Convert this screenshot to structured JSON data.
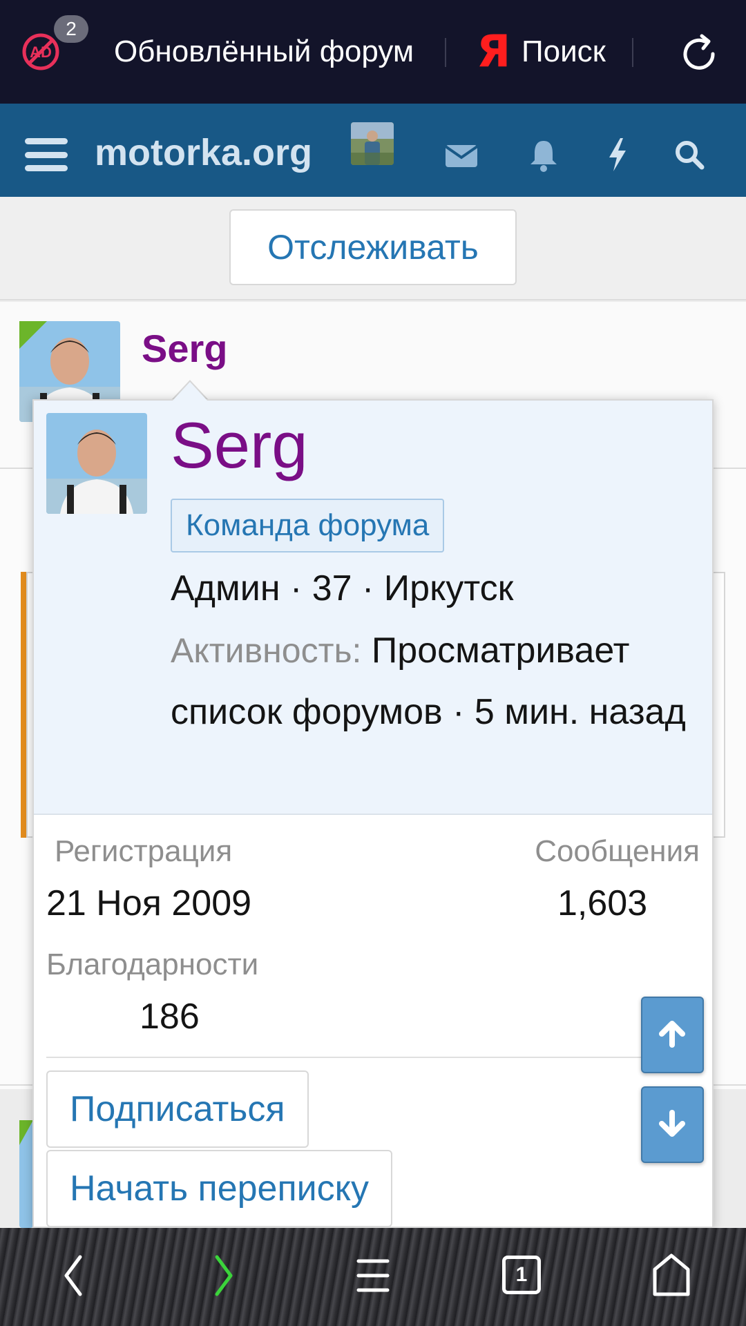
{
  "browser": {
    "adblock_count": "2",
    "tab_title": "Обновлённый форум",
    "yandex_logo": "Я",
    "search_label": "Поиск",
    "icons": [
      "adblock-icon",
      "reload-icon"
    ]
  },
  "header": {
    "site_name": "motorka.org",
    "icons": [
      "menu-icon",
      "user-avatar",
      "envelope-icon",
      "bell-icon",
      "lightning-icon",
      "search-icon"
    ],
    "color": "#185886"
  },
  "page": {
    "follow_label": "Отслеживать",
    "author_name": "Serg"
  },
  "tooltip": {
    "name": "Serg",
    "badge": "Команда форума",
    "info": "Админ · 37 · Иркутск",
    "activity_label": "Активность:",
    "activity_value": "Просматривает список форумов · 5 мин. назад",
    "stats": {
      "registration_label": "Регистрация",
      "registration_value": "21 Ноя 2009",
      "messages_label": "Сообщения",
      "messages_value": "1,603",
      "thanks_label": "Благодарности",
      "thanks_value": "186"
    },
    "subscribe_label": "Подписаться",
    "message_label": "Начать переписку",
    "name_color": "#7a0e86"
  },
  "navigation": {
    "icons": [
      "back-icon",
      "forward-icon",
      "menu-icon",
      "tabs-icon",
      "home-icon"
    ],
    "tab_count": "1",
    "forward_color": "#3bd43b"
  }
}
